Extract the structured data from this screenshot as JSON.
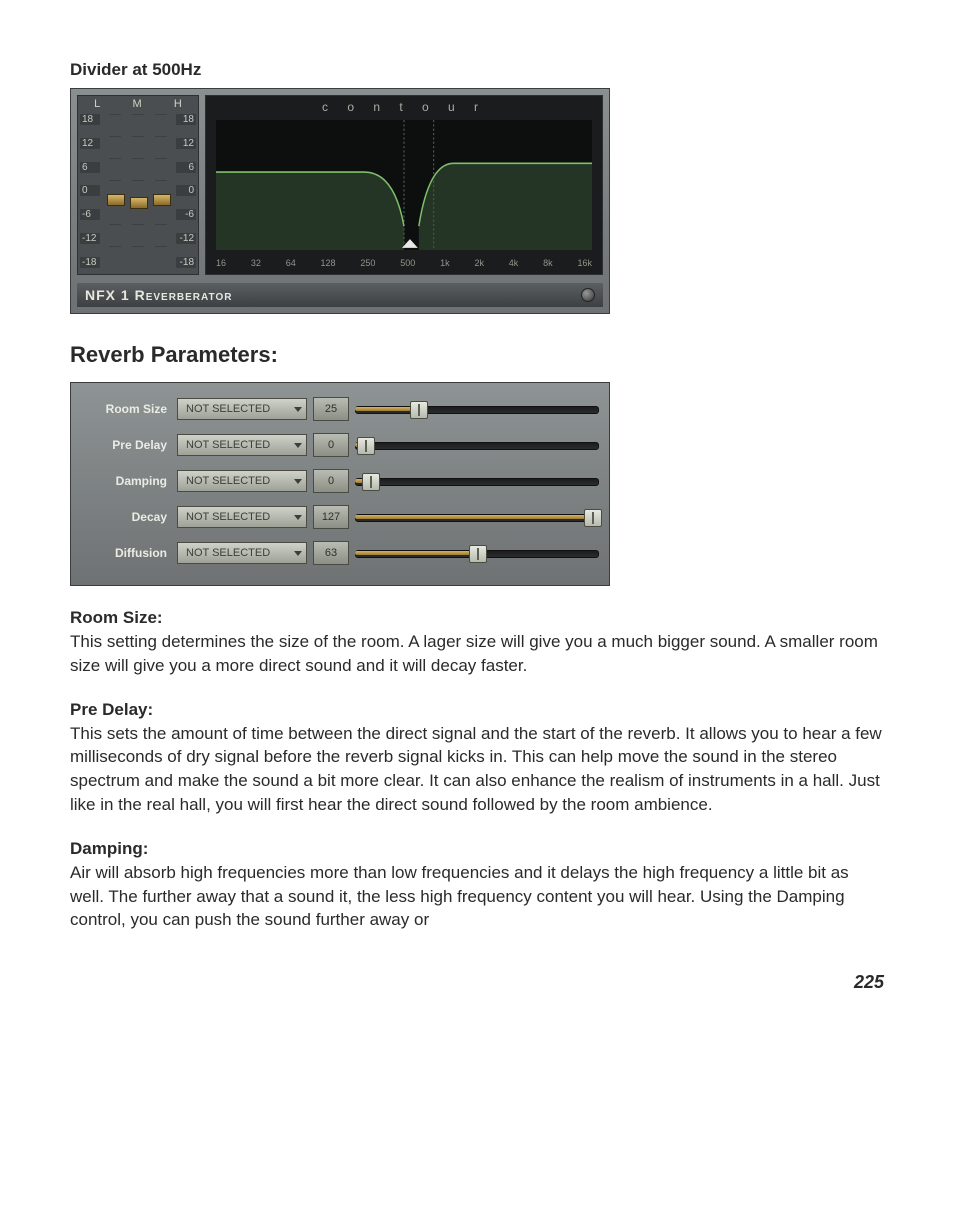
{
  "caption1": "Divider at 500Hz",
  "panel1": {
    "eq": {
      "bands": [
        "L",
        "M",
        "H"
      ],
      "scale": [
        "18",
        "12",
        "6",
        "0",
        "-6",
        "-12",
        "-18"
      ],
      "knob_positions_pct": [
        52,
        54,
        52
      ]
    },
    "contour": {
      "title": "c  o  n  t  o  u  r",
      "xlabels": [
        "16",
        "32",
        "64",
        "128",
        "250",
        "500",
        "1k",
        "2k",
        "4k",
        "8k",
        "16k"
      ]
    },
    "title": "NFX 1",
    "subtitle": "Reverberator"
  },
  "section_heading": "Reverb Parameters:",
  "params": [
    {
      "label": "Room Size",
      "select": "NOT SELECTED",
      "value": "25",
      "pos_pct": 26
    },
    {
      "label": "Pre Delay",
      "select": "NOT SELECTED",
      "value": "0",
      "pos_pct": 4
    },
    {
      "label": "Damping",
      "select": "NOT SELECTED",
      "value": "0",
      "pos_pct": 6
    },
    {
      "label": "Decay",
      "select": "NOT SELECTED",
      "value": "127",
      "pos_pct": 97
    },
    {
      "label": "Diffusion",
      "select": "NOT SELECTED",
      "value": "63",
      "pos_pct": 50
    }
  ],
  "descriptions": {
    "room_size": {
      "head": "Room Size:",
      "body": "This setting determines the size of the room.  A lager size will give you a much bigger sound.   A smaller room size will give you a more direct sound and it will decay faster."
    },
    "pre_delay": {
      "head": "Pre Delay:",
      "body": "This sets the amount of time between the direct signal and the start of the reverb.  It allows you to hear a few milliseconds of dry signal before the reverb signal kicks in.  This can help move the sound in the stereo spectrum and make the sound a bit more clear.  It can also enhance the realism of instruments in a hall.  Just like in the real hall, you will first hear the direct sound followed by the room ambience."
    },
    "damping": {
      "head": "Damping:",
      "body": "Air will absorb high frequencies more than low frequencies and it delays the high frequency a little bit as well.  The further away that a sound it, the less high frequency content you will hear.  Using the Damping control, you can push the sound further away or"
    }
  },
  "page_number": "225"
}
